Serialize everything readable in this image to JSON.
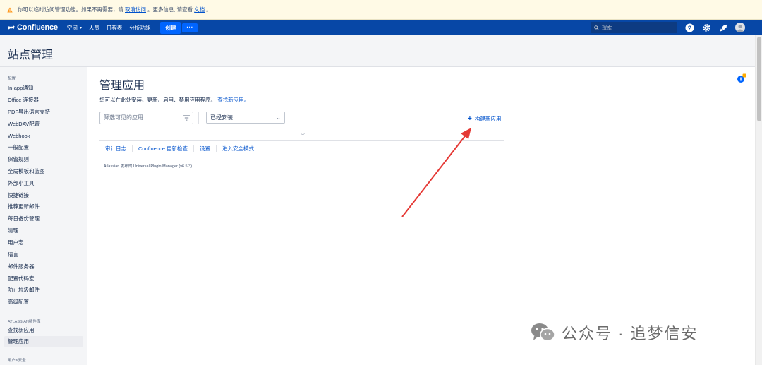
{
  "banner": {
    "text_before": "你可以临时访问管理功能。如果不再需要，请",
    "link_cancel": "取消访问",
    "text_middle": "。更多信息, 请查看",
    "link_docs": "文档",
    "text_end": "。"
  },
  "topnav": {
    "logo": "Confluence",
    "spaces": "空间",
    "people": "人员",
    "calendar": "日程表",
    "analytics": "分析功能",
    "create": "创建",
    "more": "···",
    "search_placeholder": "搜索"
  },
  "page_title": "站点管理",
  "sidebar": {
    "section_config": "配置",
    "items": [
      "In-app通知",
      "Office 连接器",
      "PDF导出语言支持",
      "WebDAV配置",
      "Webhook",
      "一般配置",
      "保留规则",
      "全局模板和蓝图",
      "外部小工具",
      "快捷链接",
      "推荐更新邮件",
      "每日备份管理",
      "清理",
      "用户宏",
      "语言",
      "邮件服务器",
      "配置代码宏",
      "防止垃圾邮件",
      "高级配置"
    ],
    "section_marketplace": "ATLASSIAN插件库",
    "marketplace_items": [
      "查找新应用",
      "管理应用"
    ],
    "section_users": "用户&安全"
  },
  "main": {
    "heading": "管理应用",
    "description": "您可以在此处安装、更新、启用、禁用应用程序。",
    "find_link": "查找新应用。",
    "filter_placeholder": "筛选可见的应用",
    "select_value": "已经安装",
    "build_link": "构建新应用",
    "links": [
      "审计日志",
      "Confluence 更新检查",
      "设置",
      "进入安全模式"
    ],
    "upm_footer": "Atlassian 发布的 Universal Plugin Manager (v6.5.3)"
  },
  "badge_count": "1",
  "watermark": "公众号 · 追梦信安",
  "colors": {
    "nav_bg": "#0747a6",
    "create_btn": "#0065ff",
    "link": "#0052cc",
    "banner_bg": "#fffae6",
    "arrow": "#e53935"
  }
}
